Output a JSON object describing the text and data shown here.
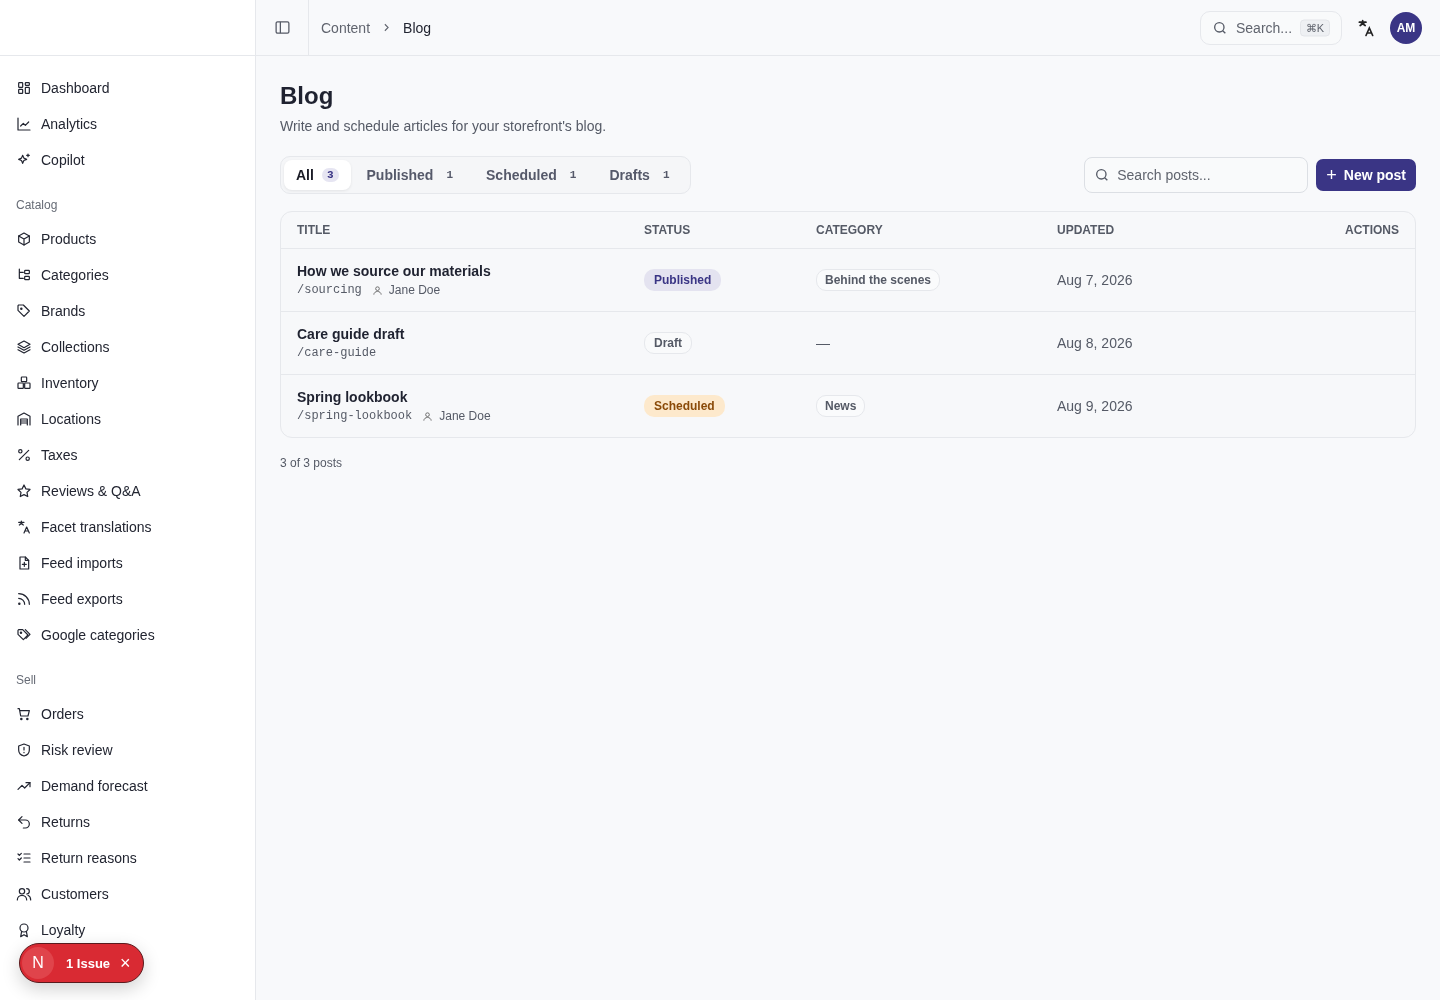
{
  "sidebar": {
    "sections": [
      {
        "items": [
          {
            "label": "Dashboard"
          },
          {
            "label": "Analytics"
          },
          {
            "label": "Copilot"
          }
        ]
      },
      {
        "title": "Catalog",
        "items": [
          {
            "label": "Products"
          },
          {
            "label": "Categories"
          },
          {
            "label": "Brands"
          },
          {
            "label": "Collections"
          },
          {
            "label": "Inventory"
          },
          {
            "label": "Locations"
          },
          {
            "label": "Taxes"
          },
          {
            "label": "Reviews & Q&A"
          },
          {
            "label": "Facet translations"
          },
          {
            "label": "Feed imports"
          },
          {
            "label": "Feed exports"
          },
          {
            "label": "Google categories"
          }
        ]
      },
      {
        "title": "Sell",
        "items": [
          {
            "label": "Orders"
          },
          {
            "label": "Risk review"
          },
          {
            "label": "Demand forecast"
          },
          {
            "label": "Returns"
          },
          {
            "label": "Return reasons"
          },
          {
            "label": "Customers"
          },
          {
            "label": "Loyalty"
          }
        ]
      }
    ]
  },
  "topbar": {
    "breadcrumb": [
      "Content",
      "Blog"
    ],
    "search": {
      "placeholder": "Search...",
      "shortcut": "⌘K"
    },
    "avatar": "AM"
  },
  "page": {
    "title": "Blog",
    "subtitle": "Write and schedule articles for your storefront's blog."
  },
  "tabs": [
    {
      "label": "All",
      "count": "3",
      "selected": true
    },
    {
      "label": "Published",
      "count": "1",
      "selected": false
    },
    {
      "label": "Scheduled",
      "count": "1",
      "selected": false
    },
    {
      "label": "Drafts",
      "count": "1",
      "selected": false
    }
  ],
  "search": {
    "placeholder": "Search posts..."
  },
  "new_button": {
    "label": "New post",
    "icon": "+"
  },
  "table": {
    "columns": [
      "TITLE",
      "STATUS",
      "CATEGORY",
      "UPDATED",
      "ACTIONS"
    ],
    "rows": [
      {
        "title": "How we source our materials",
        "slug": "/sourcing",
        "author": "Jane Doe",
        "status": {
          "label": "Published",
          "kind": "published"
        },
        "category": {
          "text": "Behind the scenes",
          "kind": "chip"
        },
        "updated": "Aug 7, 2026"
      },
      {
        "title": "Care guide draft",
        "slug": "/care-guide",
        "status": {
          "label": "Draft",
          "kind": "draft"
        },
        "category": {
          "text": "—",
          "kind": "empty"
        },
        "updated": "Aug 8, 2026"
      },
      {
        "title": "Spring lookbook",
        "slug": "/spring-lookbook",
        "author": "Jane Doe",
        "status": {
          "label": "Scheduled",
          "kind": "scheduled"
        },
        "category": {
          "text": "News",
          "kind": "chip"
        },
        "updated": "Aug 9, 2026"
      }
    ]
  },
  "footer": "3 of 3 posts",
  "toast": {
    "avatar": "N",
    "label": "1 Issue",
    "close": "×"
  }
}
